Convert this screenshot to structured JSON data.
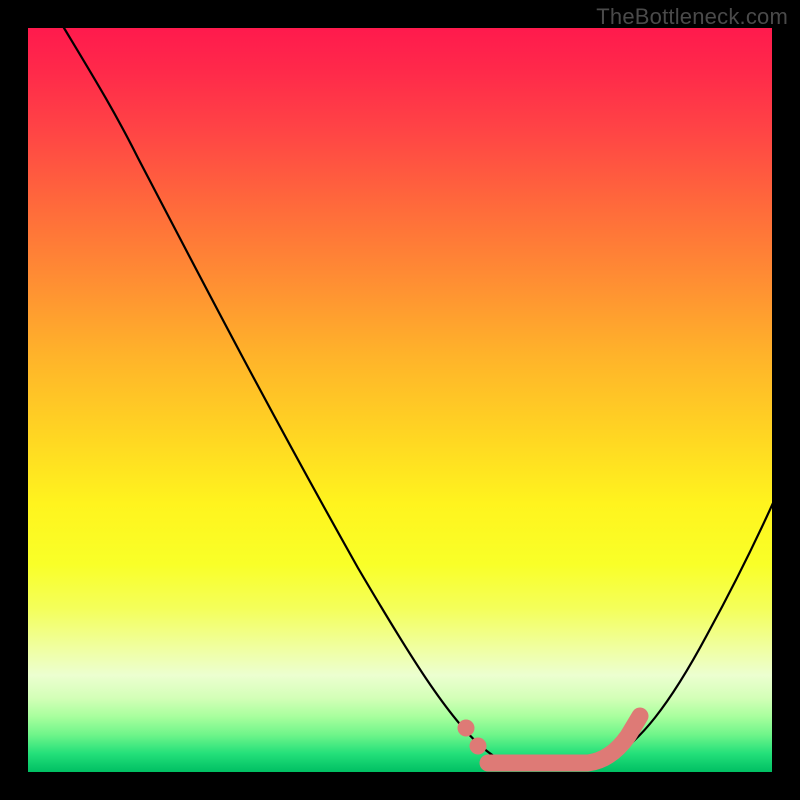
{
  "watermark": "TheBottleneck.com",
  "colors": {
    "page_bg": "#000000",
    "curve_stroke": "#000000",
    "marker_fill": "#de7a76",
    "gradient_top": "#ff1a4d",
    "gradient_bottom": "#00bf63"
  },
  "chart_data": {
    "type": "line",
    "title": "",
    "xlabel": "",
    "ylabel": "",
    "xlim": [
      0,
      100
    ],
    "ylim": [
      0,
      100
    ],
    "series": [
      {
        "name": "bottleneck-curve",
        "x": [
          0,
          5,
          10,
          15,
          20,
          25,
          30,
          35,
          40,
          45,
          50,
          55,
          60,
          62,
          65,
          70,
          75,
          80,
          85,
          90,
          95,
          100
        ],
        "y": [
          100,
          96,
          90,
          83,
          75,
          66,
          57,
          47,
          37,
          27,
          17,
          9,
          3,
          1,
          0,
          0,
          1,
          4,
          12,
          22,
          32,
          43
        ]
      }
    ],
    "markers": [
      {
        "name": "highlight-dot-1",
        "x": 58,
        "y": 5
      },
      {
        "name": "highlight-dot-2",
        "x": 60,
        "y": 2.5
      },
      {
        "name": "flat-segment",
        "x0": 62,
        "x1": 77,
        "approx_y": 0.5
      },
      {
        "name": "rise-segment",
        "x0": 77,
        "x1": 82,
        "y0": 2,
        "y1": 8
      }
    ]
  }
}
